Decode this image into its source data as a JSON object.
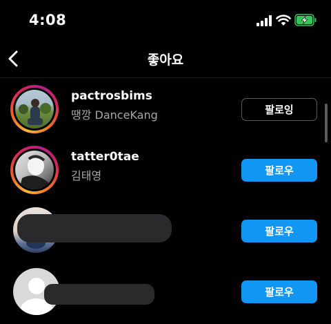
{
  "status_bar": {
    "time": "4:08",
    "icons": [
      "cellular-signal-icon",
      "wifi-icon",
      "battery-charging-icon"
    ],
    "battery_color": "#34c759"
  },
  "header": {
    "title": "좋아요",
    "back_icon": "chevron-left-icon"
  },
  "colors": {
    "background": "#000000",
    "follow_button": "#1196f3",
    "secondary_text": "#a8a8a8"
  },
  "users": [
    {
      "username": "pactrosbims",
      "full_name": "땡깡 DanceKang",
      "button_label": "팔로잉",
      "button_state": "following",
      "story_ring": true
    },
    {
      "username": "tatter0tae",
      "full_name": "김태영",
      "button_label": "팔로우",
      "button_state": "follow",
      "story_ring": true
    },
    {
      "username": "",
      "full_name": "",
      "button_label": "팔로우",
      "button_state": "follow",
      "story_ring": false,
      "redacted": true
    },
    {
      "username": "",
      "full_name": "",
      "button_label": "팔로우",
      "button_state": "follow",
      "story_ring": false,
      "redacted": true,
      "default_avatar": true
    }
  ]
}
